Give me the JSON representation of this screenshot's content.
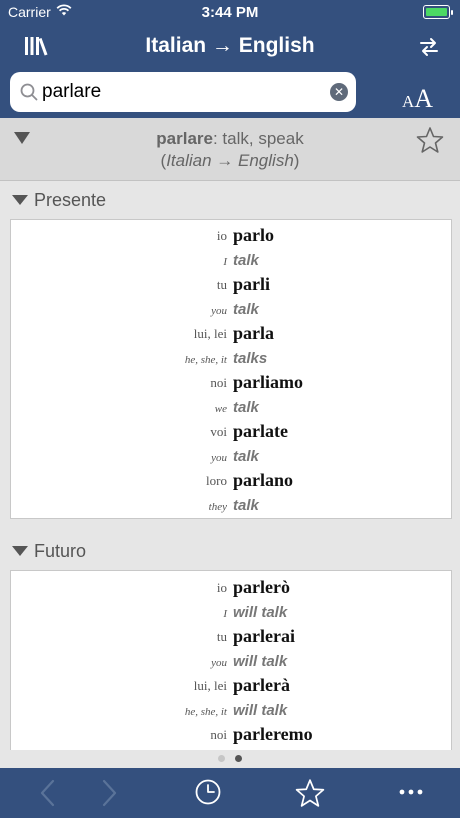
{
  "status": {
    "carrier": "Carrier",
    "time": "3:44 PM"
  },
  "nav": {
    "title": "Italian → English",
    "left_icon": "library-icon",
    "right_icon": "swap-direction-icon"
  },
  "search": {
    "value": "parlare",
    "placeholder": "Search"
  },
  "font_size": {
    "small": "A",
    "big": "A"
  },
  "entry": {
    "word": "parlare",
    "definition": ": talk, speak",
    "direction_open": "(",
    "direction": "Italian → English",
    "direction_close": ")"
  },
  "sections": [
    {
      "title": "Presente",
      "rows": [
        {
          "pronoun": "io",
          "form": "parlo",
          "en_pronoun": "I",
          "translation": "talk"
        },
        {
          "pronoun": "tu",
          "form": "parli",
          "en_pronoun": "you",
          "translation": "talk"
        },
        {
          "pronoun": "lui, lei",
          "form": "parla",
          "en_pronoun": "he, she, it",
          "translation": "talks"
        },
        {
          "pronoun": "noi",
          "form": "parliamo",
          "en_pronoun": "we",
          "translation": "talk"
        },
        {
          "pronoun": "voi",
          "form": "parlate",
          "en_pronoun": "you",
          "translation": "talk"
        },
        {
          "pronoun": "loro",
          "form": "parlano",
          "en_pronoun": "they",
          "translation": "talk"
        }
      ]
    },
    {
      "title": "Futuro",
      "rows": [
        {
          "pronoun": "io",
          "form": "parlerò",
          "en_pronoun": "I",
          "translation": "will talk"
        },
        {
          "pronoun": "tu",
          "form": "parlerai",
          "en_pronoun": "you",
          "translation": "will talk"
        },
        {
          "pronoun": "lui, lei",
          "form": "parlerà",
          "en_pronoun": "he, she, it",
          "translation": "will talk"
        },
        {
          "pronoun": "noi",
          "form": "parleremo",
          "en_pronoun": "we",
          "translation": "will talk"
        }
      ]
    }
  ],
  "page_indicator": {
    "count": 2,
    "current": 2
  },
  "toolbar": {
    "icons": [
      "back-icon",
      "forward-icon",
      "history-icon",
      "favorites-icon",
      "more-icon"
    ]
  },
  "colors": {
    "bar": "#34507e",
    "background": "#e6e6e6",
    "battery": "#4cd964"
  }
}
